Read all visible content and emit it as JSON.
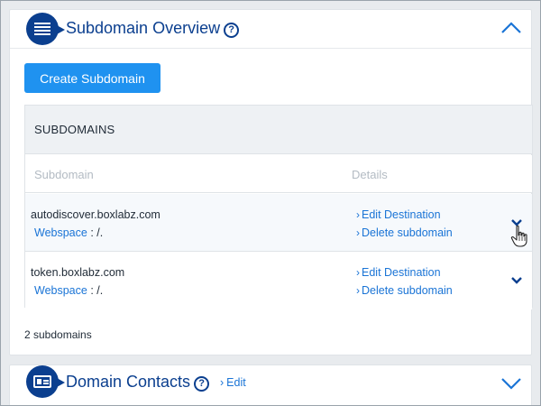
{
  "subdomain_overview": {
    "title": "Subdomain Overview",
    "help_icon": "question-circle-icon",
    "collapse_icon": "chevron-up-icon",
    "create_button": "Create Subdomain",
    "table": {
      "title": "SUBDOMAINS",
      "columns": [
        "Subdomain",
        "Details"
      ],
      "rows": [
        {
          "subdomain": "autodiscover.boxlabz.com",
          "webspace_label": "Webspace",
          "webspace_value": " : /.",
          "actions": [
            "Edit Destination",
            "Delete subdomain"
          ],
          "expand_icon": "chevron-down-icon"
        },
        {
          "subdomain": "token.boxlabz.com",
          "webspace_label": "Webspace",
          "webspace_value": " : /.",
          "actions": [
            "Edit Destination",
            "Delete subdomain"
          ],
          "expand_icon": "chevron-down-icon"
        }
      ]
    },
    "count_text": "2 subdomains"
  },
  "domain_contacts": {
    "title": "Domain Contacts",
    "help_icon": "question-circle-icon",
    "edit_link": "Edit",
    "expand_icon": "chevron-down-icon"
  },
  "colors": {
    "brand_navy": "#0b3f8f",
    "primary_button": "#1f92f0",
    "link": "#1a74d6"
  }
}
